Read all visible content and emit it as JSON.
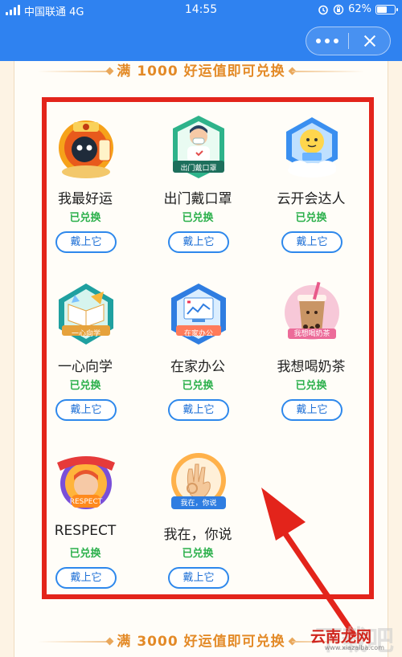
{
  "status_bar": {
    "carrier": "中国联通 4G",
    "time": "14:55",
    "battery": "62%",
    "battery_level": 0.62
  },
  "title_bar": {
    "more_icon": "more-dots-icon",
    "close_icon": "close-icon"
  },
  "sections": [
    {
      "title": "满 1000 好运值即可兑换"
    },
    {
      "title": "满 3000 好运值即可兑换"
    }
  ],
  "badges": [
    {
      "name": "我最好运",
      "status": "已兑换",
      "action": "戴上它",
      "tag": "",
      "icon": "lucky-cat-badge-icon"
    },
    {
      "name": "出门戴口罩",
      "status": "已兑换",
      "action": "戴上它",
      "tag": "出门戴口罩",
      "icon": "mask-badge-icon"
    },
    {
      "name": "云开会达人",
      "status": "已兑换",
      "action": "戴上它",
      "tag": "",
      "icon": "cloud-meeting-badge-icon"
    },
    {
      "name": "一心向学",
      "status": "已兑换",
      "action": "戴上它",
      "tag": "一心向学",
      "icon": "study-book-badge-icon"
    },
    {
      "name": "在家办公",
      "status": "已兑换",
      "action": "戴上它",
      "tag": "在家办公",
      "icon": "home-office-badge-icon"
    },
    {
      "name": "我想喝奶茶",
      "status": "已兑换",
      "action": "戴上它",
      "tag": "我想喝奶茶",
      "icon": "milk-tea-badge-icon"
    },
    {
      "name": "RESPECT",
      "status": "已兑换",
      "action": "戴上它",
      "tag": "RESPECT",
      "icon": "respect-badge-icon"
    },
    {
      "name": "我在，你说",
      "status": "已兑换",
      "action": "戴上它",
      "tag": "我在，你说",
      "icon": "ok-hand-badge-icon"
    }
  ],
  "watermark": {
    "big": "下载吧",
    "site": "云南龙网",
    "url": "www.xiazaiba.com"
  }
}
